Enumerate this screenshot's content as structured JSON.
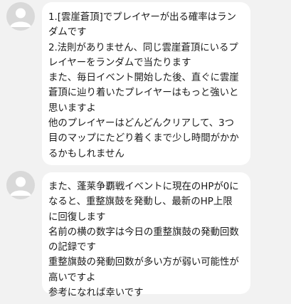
{
  "messages": [
    {
      "lines": [
        "1.[雲崖蒼頂]でプレイヤーが出る確率はラン",
        "ダムです",
        "2.法則がありません、同じ雲崖蒼頂にいるプ",
        "レイヤーをランダムで当たります",
        "また、毎日イベント開始した後、直ぐに雲崖",
        "蒼頂に辿り着いたプレイヤーはもっと強いと",
        "思いますよ",
        "他のプレイヤーはどんどんクリアして、3つ",
        "目のマップにたどり着くまで少し時間がかか",
        "るかもしれません"
      ]
    },
    {
      "lines": [
        "また、蓬莱争覇戦イベントに現在のHPが0に",
        "なると、重整旗鼓を発動し、最新のHP上限",
        "に回復します",
        "名前の横の数字は今日の重整旗鼓の発動回数",
        "の記録です",
        "重整旗鼓の発動回数が多い方が弱い可能性が",
        "高いですよ",
        "参考になれば幸いです"
      ]
    }
  ],
  "colors": {
    "background": "#f2f2f2",
    "bubble": "#ffffff",
    "avatar": "#d9d9d9",
    "avatar_figure": "#ffffff",
    "text": "#1a1a1a"
  }
}
